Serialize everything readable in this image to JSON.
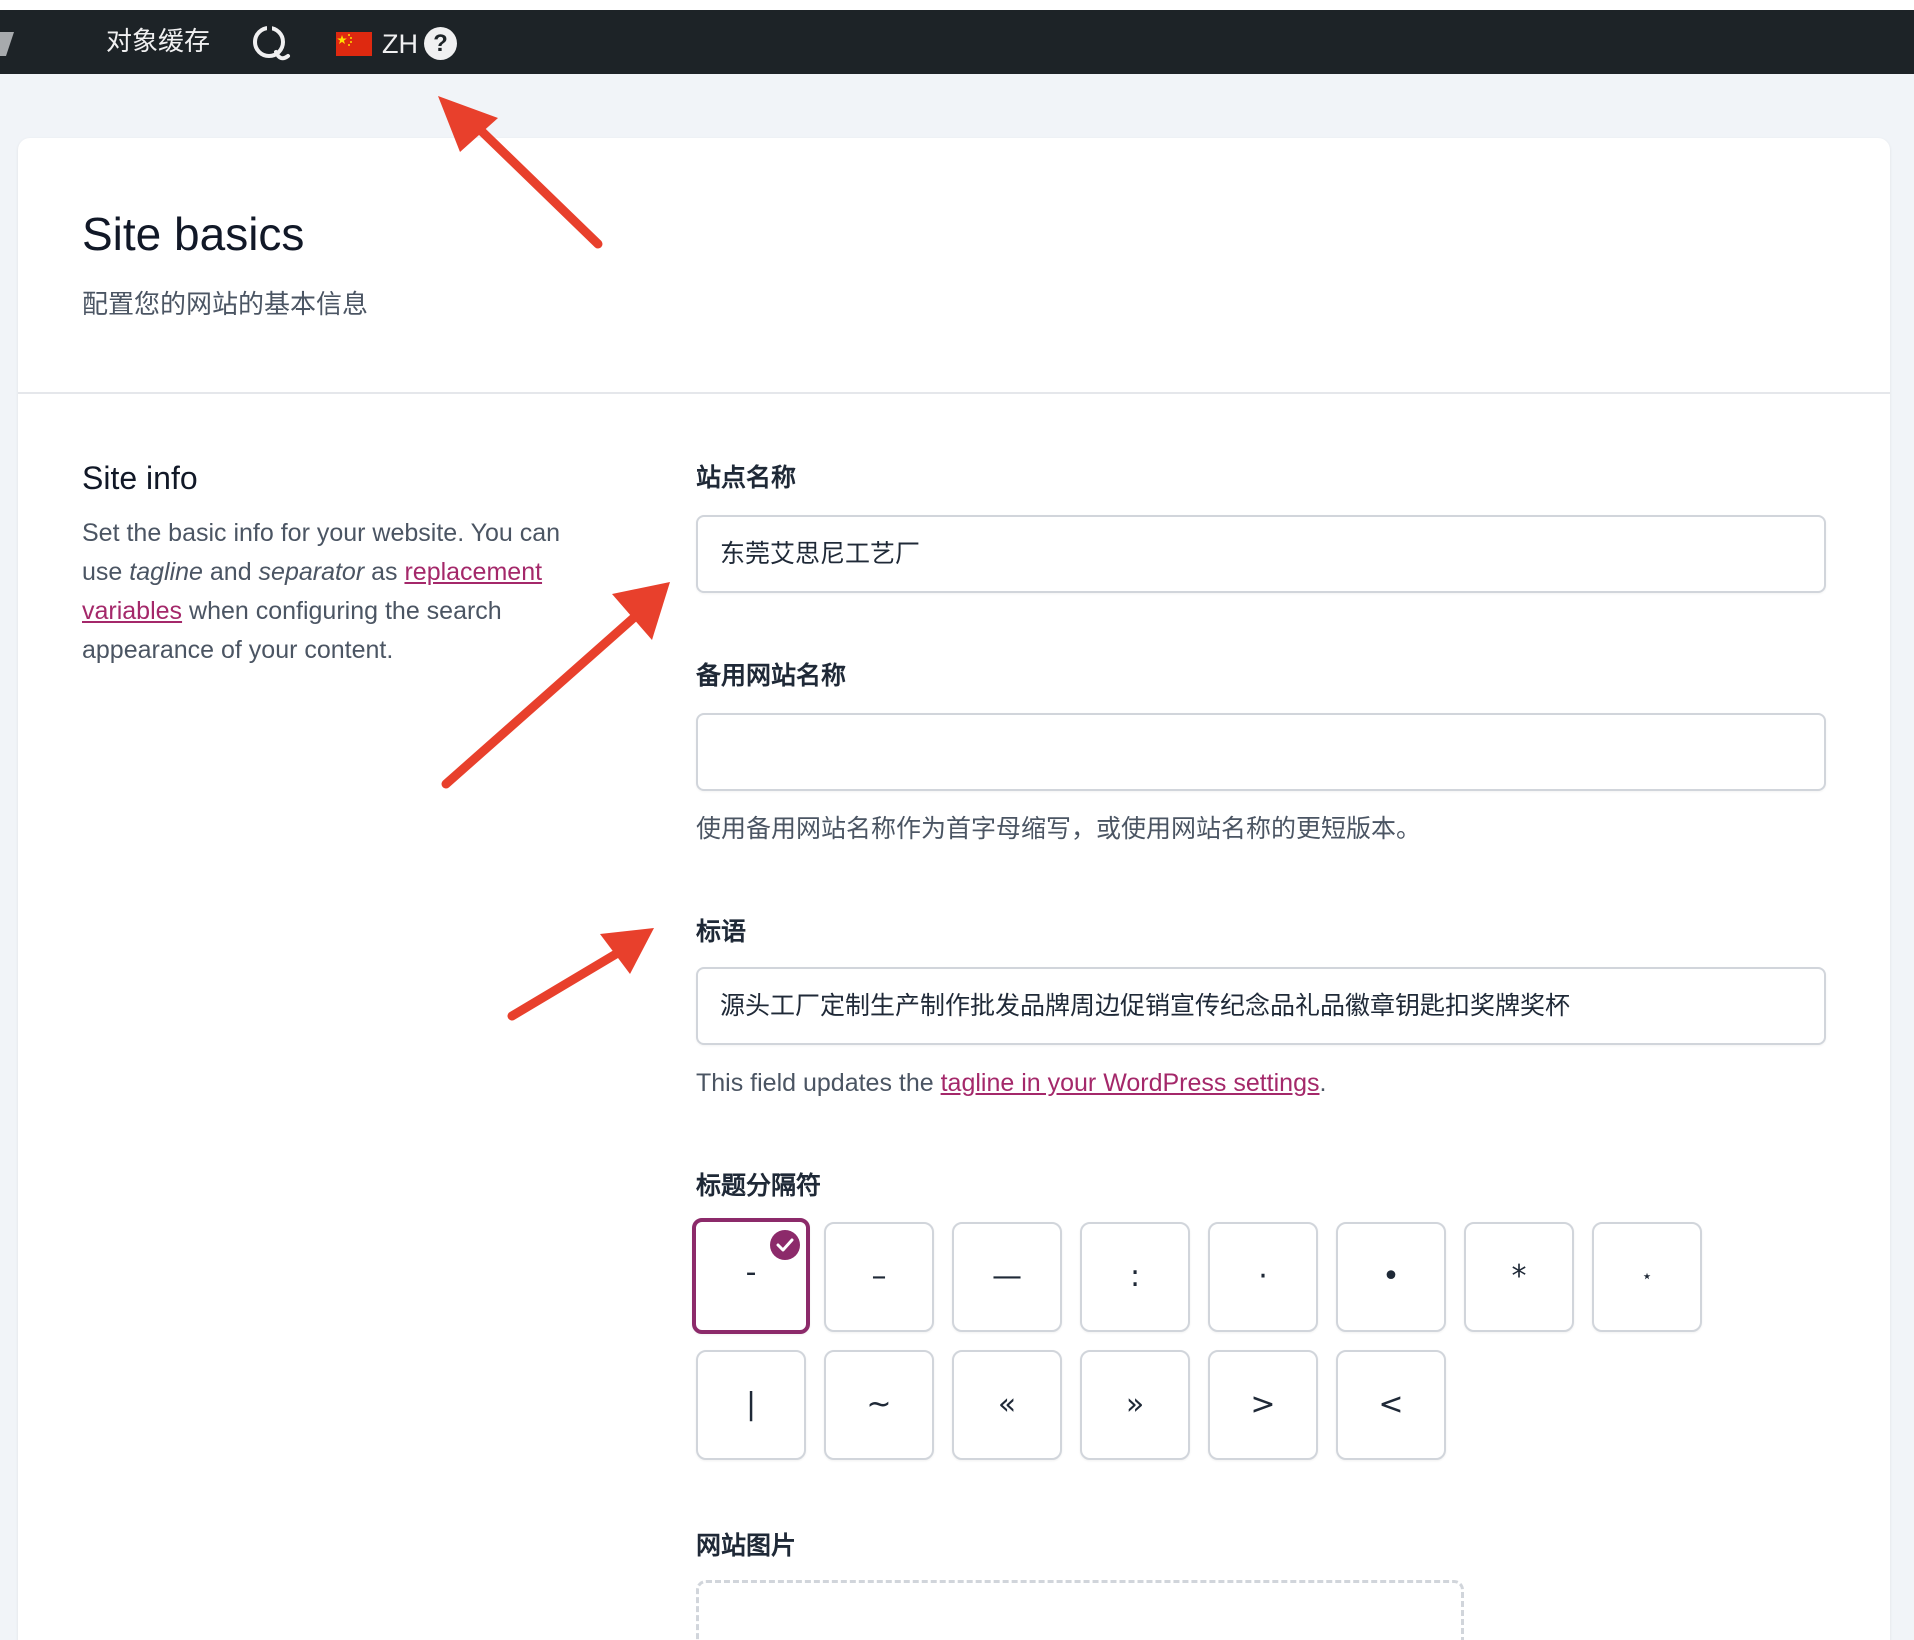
{
  "adminbar": {
    "cache_label": "对象缓存",
    "language_code": "ZH",
    "help_label": "?"
  },
  "header": {
    "title": "Site basics",
    "subtitle": "配置您的网站的基本信息"
  },
  "site_info": {
    "title": "Site info",
    "desc_part1": "Set the basic info for your website. You can use ",
    "desc_em1": "tagline",
    "desc_part2": " and ",
    "desc_em2": "separator",
    "desc_part3": " as ",
    "desc_link": "replacement variables",
    "desc_part4": " when configuring the search appearance of your content."
  },
  "fields": {
    "site_name": {
      "label": "站点名称",
      "value": "东莞艾思尼工艺厂"
    },
    "alt_site_name": {
      "label": "备用网站名称",
      "value": "",
      "help": "使用备用网站名称作为首字母缩写，或使用网站名称的更短版本。"
    },
    "tagline": {
      "label": "标语",
      "value": "源头工厂定制生产制作批发品牌周边促销宣传纪念品礼品徽章钥匙扣奖牌奖杯",
      "help_prefix": "This field updates the ",
      "help_link": "tagline in your WordPress settings",
      "help_suffix": "."
    },
    "separator": {
      "label": "标题分隔符",
      "options": [
        "-",
        "–",
        "—",
        ":",
        "·",
        "•",
        "*",
        "⋆",
        "|",
        "~",
        "«",
        "»",
        ">",
        "<"
      ],
      "selected": "-"
    },
    "site_image": {
      "label": "网站图片"
    }
  },
  "colors": {
    "accent": "#a4286a",
    "selected_border": "#8c2a6a",
    "adminbar": "#1d2327",
    "annotation_arrow": "#e8402c"
  }
}
